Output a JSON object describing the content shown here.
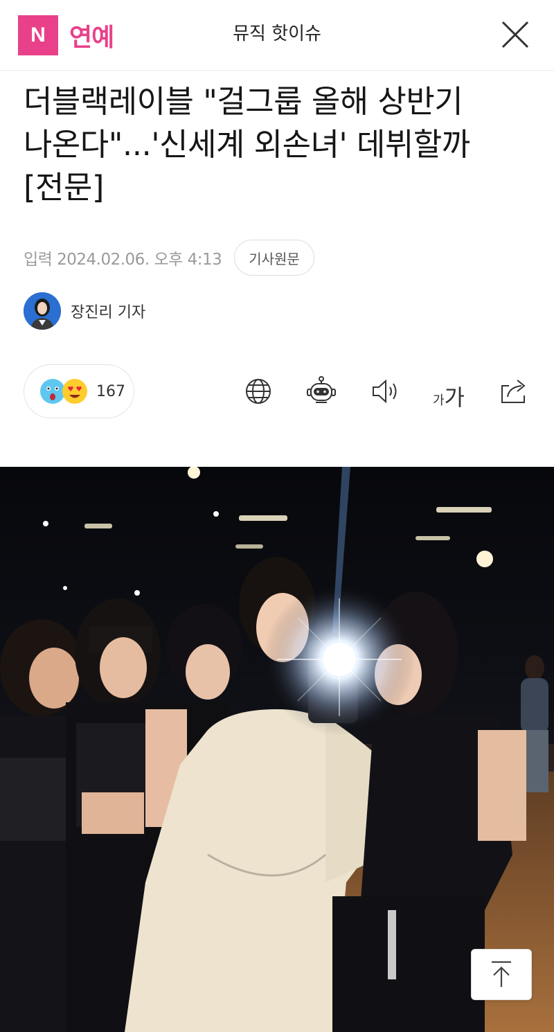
{
  "header": {
    "logo_letter": "N",
    "section": "연예",
    "center_title": "뮤직 핫이슈",
    "brand_color": "#e8418a"
  },
  "article": {
    "headline_lines": [
      "더블랙레이블 \"걸그룹 올해 상반기",
      "나온다\"...'신세계 외손녀' 데뷔할까",
      "[전문]"
    ],
    "date": "입력 2024.02.06. 오후 4:13",
    "source_button": "기사원문",
    "author": "장진리 기자"
  },
  "toolbar": {
    "reaction_count": "167",
    "font_small": "가",
    "font_large": "가",
    "icons": [
      "globe-icon",
      "robot-icon",
      "speaker-icon",
      "font-size-icon",
      "share-icon"
    ]
  },
  "photo": {
    "description_icon": "group-mirror-selfie-photo"
  },
  "scroll_top": {
    "icon": "arrow-up-icon"
  }
}
